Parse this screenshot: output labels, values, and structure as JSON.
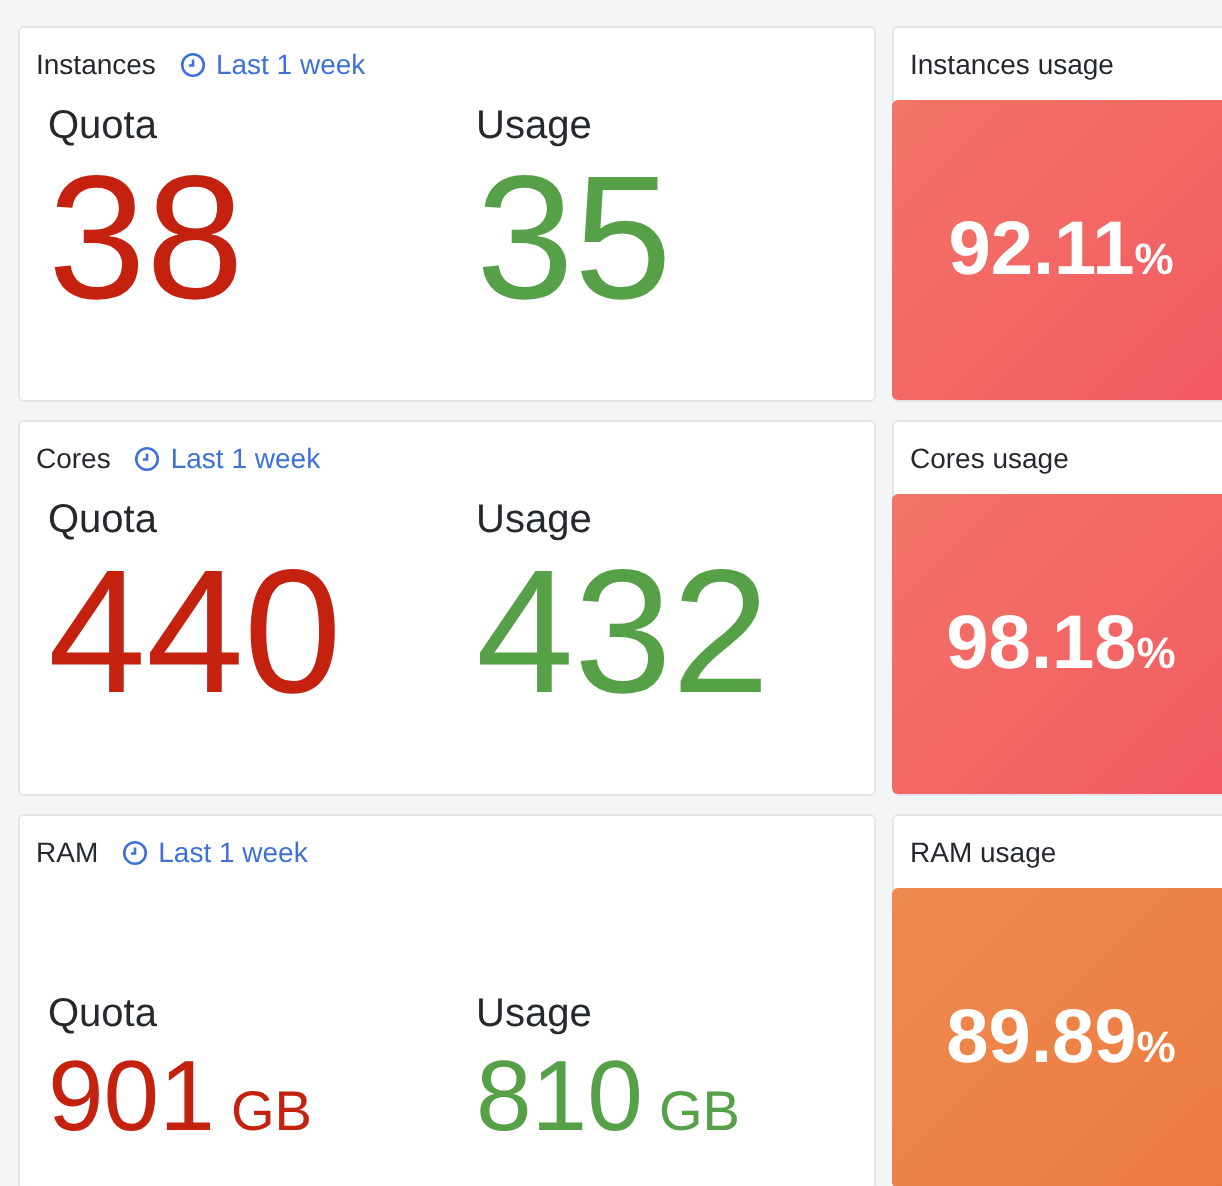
{
  "rows": [
    {
      "title": "Instances",
      "time_range": "Last 1 week",
      "kind": "large",
      "quota": {
        "label": "Quota",
        "value": "38"
      },
      "usage": {
        "label": "Usage",
        "value": "35"
      },
      "usage_panel": {
        "title": "Instances usage",
        "value": "92.11",
        "unit": "%",
        "color": "#f25a62"
      }
    },
    {
      "title": "Cores",
      "time_range": "Last 1 week",
      "kind": "large",
      "quota": {
        "label": "Quota",
        "value": "440"
      },
      "usage": {
        "label": "Usage",
        "value": "432"
      },
      "usage_panel": {
        "title": "Cores usage",
        "value": "98.18",
        "unit": "%",
        "color": "#f25a62"
      }
    },
    {
      "title": "RAM",
      "time_range": "Last 1 week",
      "kind": "small",
      "quota": {
        "label": "Quota",
        "value": "901",
        "unit": "GB"
      },
      "usage": {
        "label": "Usage",
        "value": "810",
        "unit": "GB"
      },
      "usage_panel": {
        "title": "RAM usage",
        "value": "89.89",
        "unit": "%",
        "color": "#ec7a40"
      }
    }
  ]
}
